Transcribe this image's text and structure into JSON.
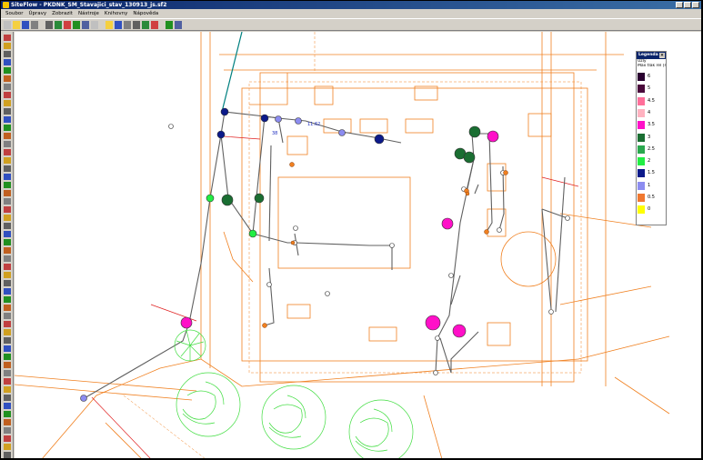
{
  "window": {
    "title": "SiteFlow - PKDNK_SM_Stavajici_stav_130913_js.sf2"
  },
  "menu": [
    "Soubor",
    "Úpravy",
    "Zobrazit",
    "Nástroje",
    "Knihovny",
    "Nápověda"
  ],
  "toolbar": {
    "buttons": [
      "new-icon",
      "open-icon",
      "save-icon",
      "print-icon",
      "zoom-icon",
      "zoom-window-icon",
      "zoom-in-icon",
      "zoom-out-icon",
      "zoom-extents-icon",
      "measure-icon",
      "select-icon",
      "select-area-icon",
      "move-icon",
      "pipe-tool-icon",
      "node-tool-icon",
      "delete-icon",
      "flow-icon",
      "properties-icon"
    ]
  },
  "left_tools": {
    "count": 52
  },
  "canvas": {
    "annotations": [
      "38",
      "11.62"
    ]
  },
  "legend": {
    "title": "Legenda",
    "subtitle1": "Uzly",
    "subtitle2": "Max tlak rel [m]",
    "items": [
      {
        "value": "5",
        "color": "#4b0a3c"
      },
      {
        "value": "4.5",
        "color": "#ff6f9a"
      },
      {
        "value": "4",
        "color": "#ffb2c0"
      },
      {
        "value": "3.5",
        "color": "#ff10c8"
      },
      {
        "value": "3",
        "color": "#1a6e32"
      },
      {
        "value": "2.5",
        "color": "#2aa84e"
      },
      {
        "value": "2",
        "color": "#22ee44"
      },
      {
        "value": "1.5",
        "color": "#0c1a8a"
      },
      {
        "value": "1",
        "color": "#8c8cf0"
      },
      {
        "value": "0.5",
        "color": "#f07830"
      },
      {
        "value": "0",
        "color": "#ffff00"
      }
    ],
    "top_value": "6",
    "top_color": "#2a0030"
  }
}
